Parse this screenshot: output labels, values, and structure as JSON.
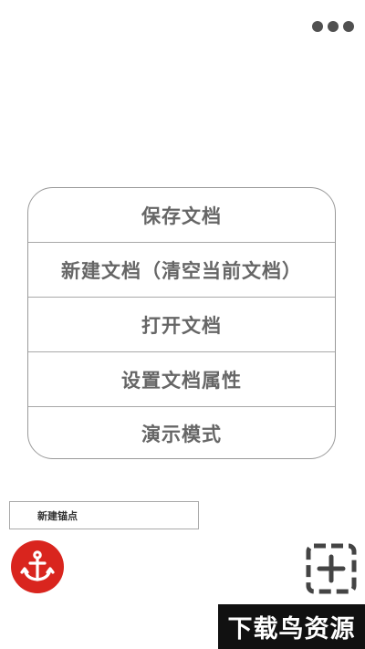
{
  "menu": {
    "items": [
      {
        "label": "保存文档"
      },
      {
        "label": "新建文档（清空当前文档）"
      },
      {
        "label": "打开文档"
      },
      {
        "label": "设置文档属性"
      },
      {
        "label": "演示模式"
      }
    ]
  },
  "anchor": {
    "input_value": "新建锚点"
  },
  "watermark": {
    "text": "下载鸟资源"
  },
  "colors": {
    "accent_red": "#d9251e",
    "menu_text": "#666666",
    "dots": "#505050"
  },
  "icons": {
    "more": "more-horizontal-icon",
    "anchor": "anchor-icon",
    "add": "add-square-dashed-icon"
  }
}
